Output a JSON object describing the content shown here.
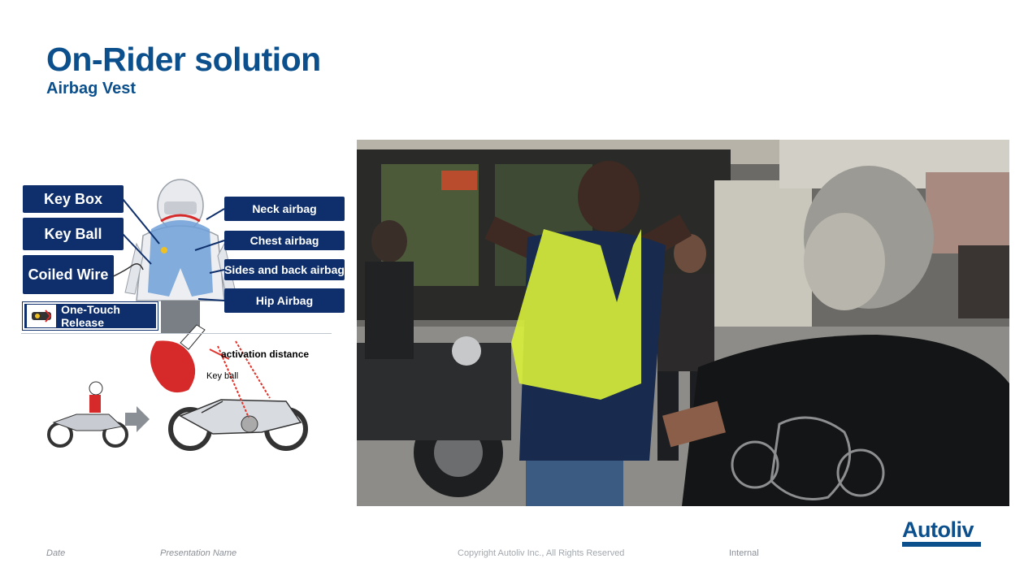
{
  "slide": {
    "title": "On-Rider solution",
    "subtitle": "Airbag Vest"
  },
  "diagram": {
    "left_labels": [
      "Key Box",
      "Key Ball",
      "Coiled Wire"
    ],
    "right_labels": [
      "Neck airbag",
      "Chest airbag",
      "Sides and back airbag",
      "Hip Airbag"
    ],
    "release_label": "One-Touch Release",
    "activation_label": "activation distance",
    "keyball_label": "Key ball"
  },
  "footer": {
    "date": "Date",
    "presentation": "Presentation Name",
    "copyright": "Copyright Autoliv Inc., All Rights Reserved",
    "classification": "Internal",
    "logo": "Autoliv"
  },
  "colors": {
    "brand": "#0b4f8c",
    "label_bg": "#0e2f6b",
    "airbag_red": "#d62a2a",
    "vest_yellow": "#d8f03a"
  }
}
